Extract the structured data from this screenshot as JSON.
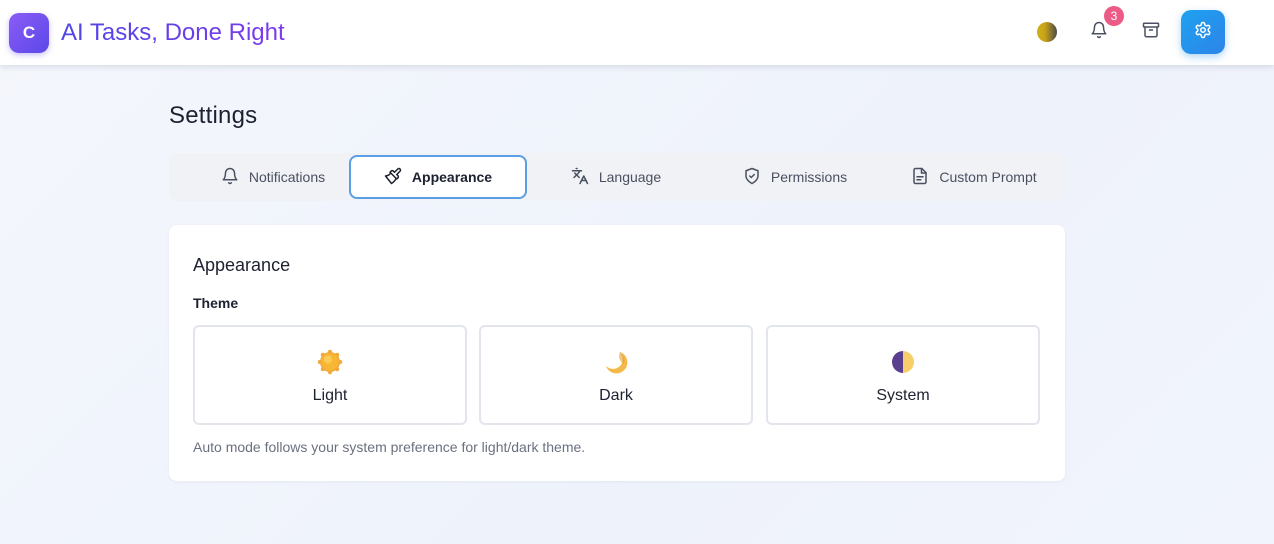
{
  "app": {
    "logo_letter": "C",
    "title": "AI Tasks, Done Right"
  },
  "header": {
    "notification_count": "3",
    "icons": [
      "theme-toggle-icon",
      "bell-icon",
      "archive-icon",
      "gear-icon"
    ]
  },
  "page": {
    "title": "Settings"
  },
  "tabs": [
    {
      "label": "Notifications",
      "icon": "bell-icon",
      "active": false
    },
    {
      "label": "Appearance",
      "icon": "brush-icon",
      "active": true
    },
    {
      "label": "Language",
      "icon": "translate-icon",
      "active": false
    },
    {
      "label": "Permissions",
      "icon": "shield-icon",
      "active": false
    },
    {
      "label": "Custom Prompt",
      "icon": "document-icon",
      "active": false
    }
  ],
  "appearance": {
    "title": "Appearance",
    "theme_label": "Theme",
    "options": [
      {
        "label": "Light",
        "icon": "sun-icon"
      },
      {
        "label": "Dark",
        "icon": "moon-icon"
      },
      {
        "label": "System",
        "icon": "half-circle-icon"
      }
    ],
    "hint": "Auto mode follows your system preference for light/dark theme."
  },
  "colors": {
    "accent": "#2c84e8",
    "brand": "#5b48e8",
    "badge": "#ec5a86",
    "active_tab_border": "#5a9ee6"
  }
}
